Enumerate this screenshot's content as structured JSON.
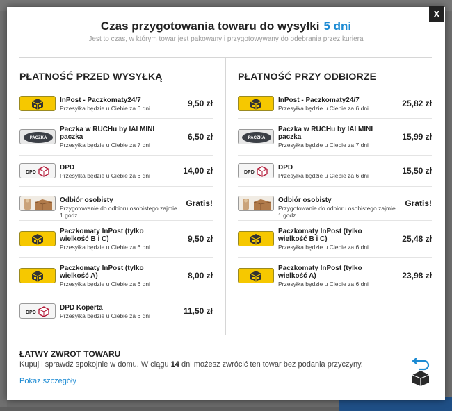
{
  "header": {
    "title": "Czas przygotowania towaru do wysyłki",
    "days": "5 dni",
    "subtitle": "Jest to czas, w którym towar jest pakowany i przygotowywany do odebrania przez kuriera",
    "close_label": "x"
  },
  "before": {
    "heading": "PŁATNOŚĆ PRZED WYSYŁKĄ",
    "items": [
      {
        "logo": "inpost",
        "name": "InPost - Paczkomaty24/7",
        "desc": "Przesyłka będzie u Ciebie za 6 dni",
        "price": "9,50 zł"
      },
      {
        "logo": "ruch",
        "name": "Paczka w RUCHu by IAI MINI paczka",
        "desc": "Przesyłka będzie u Ciebie za 7 dni",
        "price": "6,50 zł"
      },
      {
        "logo": "dpd",
        "name": "DPD",
        "desc": "Przesyłka będzie u Ciebie za 6 dni",
        "price": "14,00 zł"
      },
      {
        "logo": "personal",
        "name": "Odbiór osobisty",
        "desc": "Przygotowanie do odbioru osobistego zajmie 1 godz.",
        "price": "Gratis!"
      },
      {
        "logo": "inpost",
        "name": "Paczkomaty InPost (tylko wielkość B i C)",
        "desc": "Przesyłka będzie u Ciebie za 6 dni",
        "price": "9,50 zł"
      },
      {
        "logo": "inpost",
        "name": "Paczkomaty InPost (tylko wielkość A)",
        "desc": "Przesyłka będzie u Ciebie za 6 dni",
        "price": "8,00 zł"
      },
      {
        "logo": "dpd",
        "name": "DPD Koperta",
        "desc": "Przesyłka będzie u Ciebie za 6 dni",
        "price": "11,50 zł"
      }
    ]
  },
  "on_delivery": {
    "heading": "PŁATNOŚĆ PRZY ODBIORZE",
    "items": [
      {
        "logo": "inpost",
        "name": "InPost - Paczkomaty24/7",
        "desc": "Przesyłka będzie u Ciebie za 6 dni",
        "price": "25,82 zł"
      },
      {
        "logo": "ruch",
        "name": "Paczka w RUCHu by IAI MINI paczka",
        "desc": "Przesyłka będzie u Ciebie za 7 dni",
        "price": "15,99 zł"
      },
      {
        "logo": "dpd",
        "name": "DPD",
        "desc": "Przesyłka będzie u Ciebie za 6 dni",
        "price": "15,50 zł"
      },
      {
        "logo": "personal",
        "name": "Odbiór osobisty",
        "desc": "Przygotowanie do odbioru osobistego zajmie 1 godz.",
        "price": "Gratis!"
      },
      {
        "logo": "inpost",
        "name": "Paczkomaty InPost (tylko wielkość B i C)",
        "desc": "Przesyłka będzie u Ciebie za 6 dni",
        "price": "25,48 zł"
      },
      {
        "logo": "inpost",
        "name": "Paczkomaty InPost (tylko wielkość A)",
        "desc": "Przesyłka będzie u Ciebie za 6 dni",
        "price": "23,98 zł"
      }
    ]
  },
  "returns": {
    "title": "ŁATWY ZWROT TOWARU",
    "text_before": "Kupuj i sprawdź spokojnie w domu. W ciągu ",
    "days": "14",
    "text_after": " dni możesz zwrócić ten towar bez podania przyczyny.",
    "link": "Pokaż szczegóły",
    "icon": "return-box-icon"
  },
  "colors": {
    "accent": "#1b8ad3",
    "inpost": "#f6c800",
    "overlay": "#6a6a6a"
  }
}
